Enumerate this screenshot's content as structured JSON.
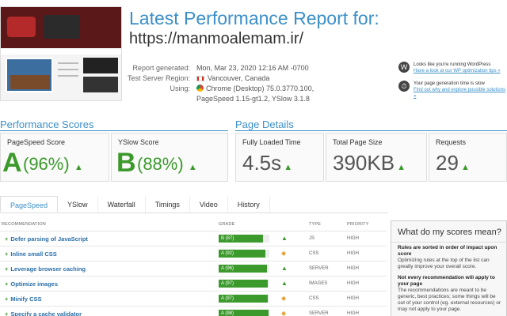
{
  "header": {
    "title": "Latest Performance Report for:",
    "url": "https://manmoalemam.ir/"
  },
  "meta": [
    {
      "label": "Report generated:",
      "value": "Mon, Mar 23, 2020 12:16 AM -0700"
    },
    {
      "label": "Test Server Region:",
      "value": "Vancouver, Canada"
    },
    {
      "label": "Using:",
      "value": "Chrome (Desktop) 75.0.3770.100, PageSpeed 1.15-gt1.2, YSlow 3.1.8"
    }
  ],
  "tips": [
    {
      "icon": "wordpress-icon",
      "text": "Looks like you're running WordPress",
      "link": "Have a look at our WP optimization tips »"
    },
    {
      "icon": "stopwatch-icon",
      "text": "Your page generation time is slow",
      "link": "Find out why and explore possible solutions »"
    }
  ],
  "performance": {
    "title": "Performance Scores",
    "pagespeed": {
      "label": "PageSpeed Score",
      "grade": "A",
      "pct": "(96%)"
    },
    "yslow": {
      "label": "YSlow Score",
      "grade": "B",
      "pct": "(88%)"
    }
  },
  "details": {
    "title": "Page Details",
    "loaded": {
      "label": "Fully Loaded Time",
      "value": "4.5s"
    },
    "size": {
      "label": "Total Page Size",
      "value": "390KB"
    },
    "requests": {
      "label": "Requests",
      "value": "29"
    }
  },
  "tabs": [
    "PageSpeed",
    "YSlow",
    "Waterfall",
    "Timings",
    "Video",
    "History"
  ],
  "table": {
    "headers": {
      "rec": "RECOMMENDATION",
      "grade": "GRADE",
      "type": "TYPE",
      "priority": "PRIORITY"
    },
    "rows": [
      {
        "name": "Defer parsing of JavaScript",
        "grade": "B (87)",
        "score": 87,
        "trend": "up",
        "type": "JS",
        "priority": "HIGH"
      },
      {
        "name": "Inline small CSS",
        "grade": "A (92)",
        "score": 92,
        "trend": "same",
        "type": "CSS",
        "priority": "HIGH"
      },
      {
        "name": "Leverage browser caching",
        "grade": "A (96)",
        "score": 96,
        "trend": "up",
        "type": "SERVER",
        "priority": "HIGH"
      },
      {
        "name": "Optimize images",
        "grade": "A (97)",
        "score": 97,
        "trend": "up",
        "type": "IMAGES",
        "priority": "HIGH"
      },
      {
        "name": "Minify CSS",
        "grade": "A (97)",
        "score": 97,
        "trend": "same",
        "type": "CSS",
        "priority": "HIGH"
      },
      {
        "name": "Specify a cache validator",
        "grade": "A (98)",
        "score": 98,
        "trend": "same",
        "type": "SERVER",
        "priority": "HIGH"
      }
    ]
  },
  "panel": {
    "title": "What do my scores mean?",
    "p1_bold": "Rules are sorted in order of impact upon score",
    "p1": "Optimizing rules at the top of the list can greatly improve your overall score.",
    "p2_bold": "Not every recommendation will apply to your page",
    "p2": "The recommendations are meant to be generic, best practices; some things will be out of your control (eg. external resources) or may not apply to your page."
  },
  "colors": {
    "accent": "#3b8fc9",
    "good": "#3c9a2c",
    "warn": "#e8a33a"
  }
}
